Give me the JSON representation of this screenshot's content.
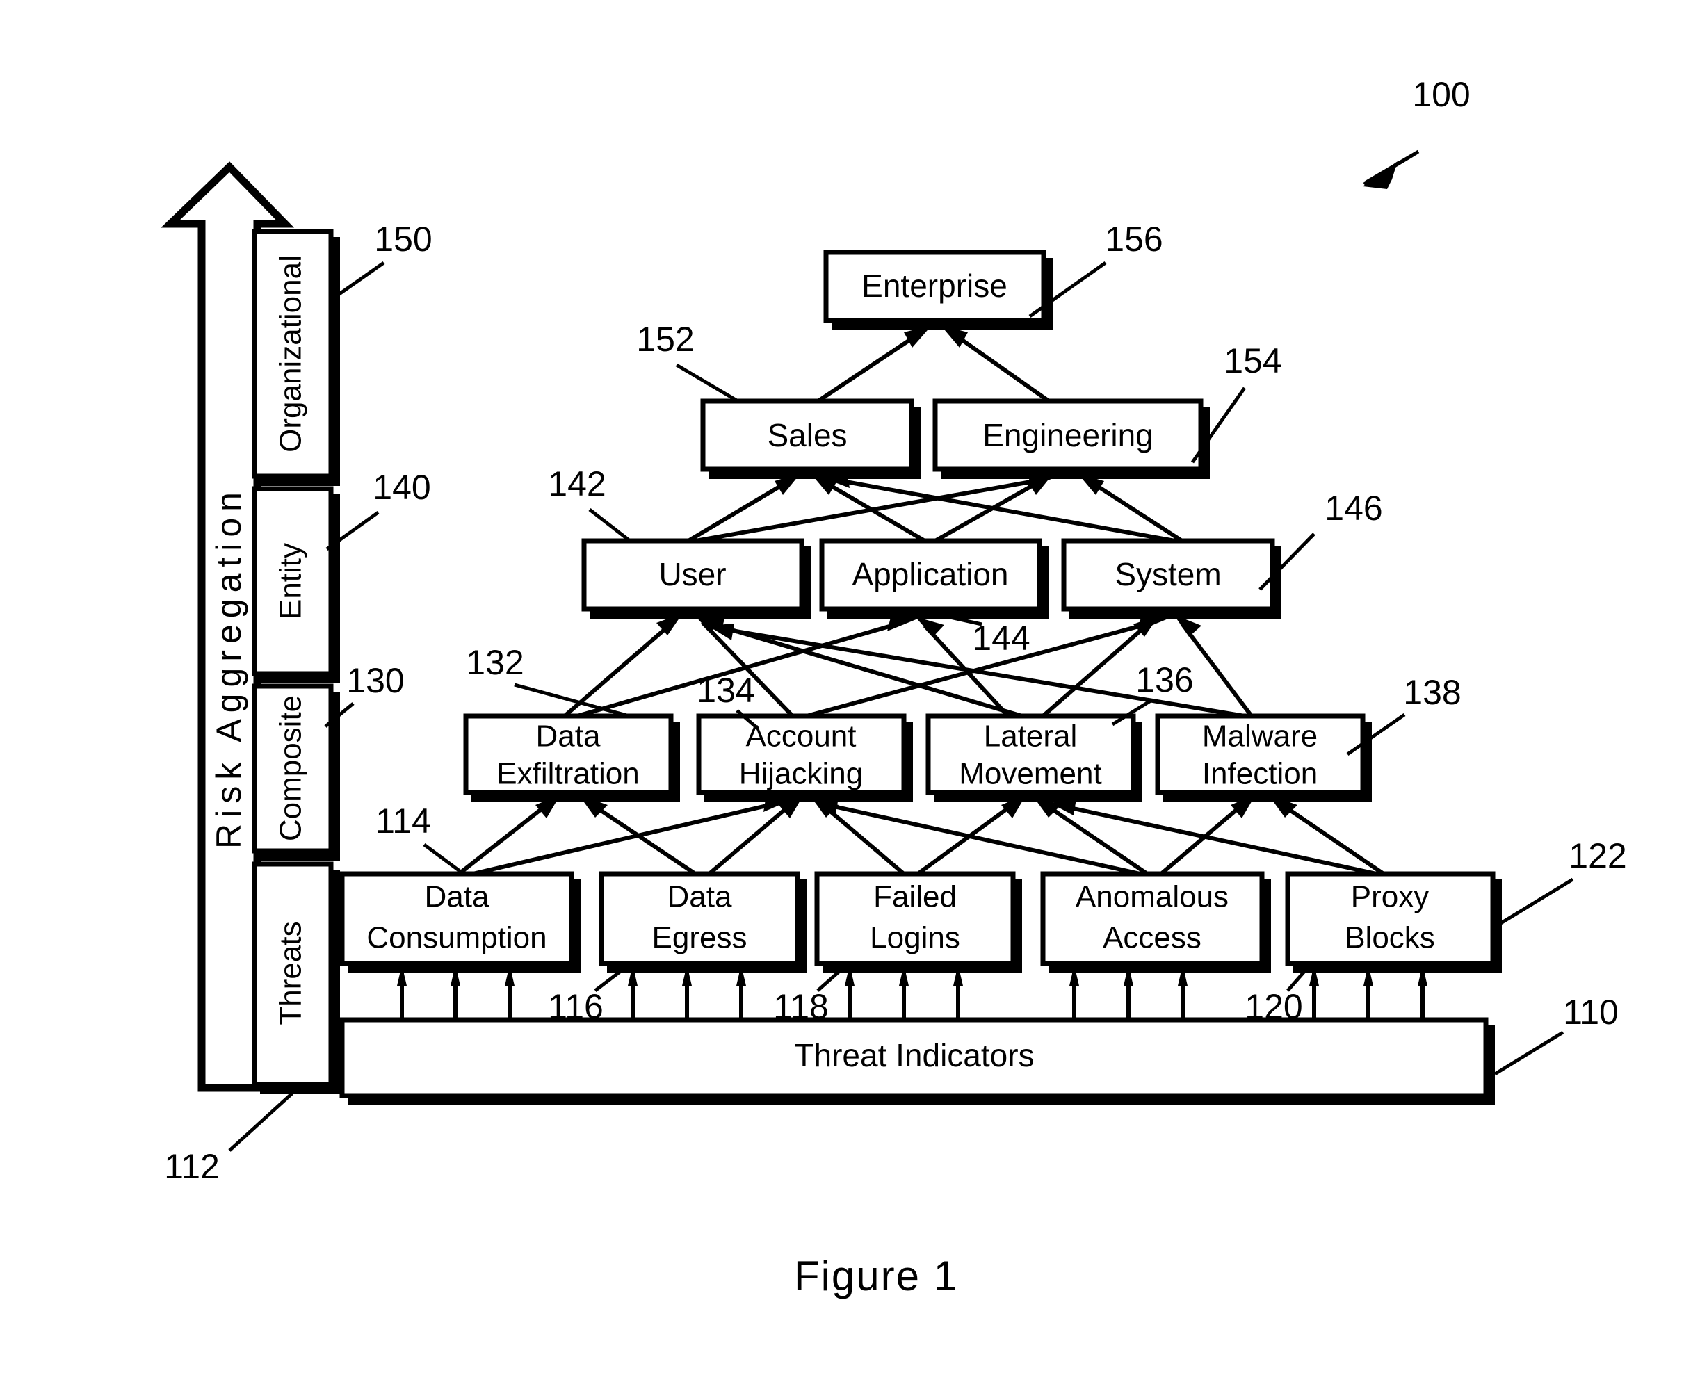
{
  "figure": {
    "caption": "Figure  1",
    "system_ref": "100"
  },
  "axis": {
    "label": "Risk Aggregation",
    "direction": "upward"
  },
  "layers": [
    {
      "label": "Organizational",
      "ref": "150"
    },
    {
      "label": "Entity",
      "ref": "140"
    },
    {
      "label": "Composite",
      "ref": "130"
    },
    {
      "label": "Threats",
      "ref": "112"
    }
  ],
  "organizational": {
    "nodes": [
      {
        "label": "Enterprise",
        "ref": "156"
      },
      {
        "label": "Sales",
        "ref": "152"
      },
      {
        "label": "Engineering",
        "ref": "154"
      }
    ]
  },
  "entity": {
    "nodes": [
      {
        "label": "User",
        "ref": "142"
      },
      {
        "label": "Application",
        "ref": "144"
      },
      {
        "label": "System",
        "ref": "146"
      }
    ]
  },
  "composite": {
    "nodes": [
      {
        "line1": "Data",
        "line2": "Exfiltration",
        "ref": "132"
      },
      {
        "line1": "Account",
        "line2": "Hijacking",
        "ref": "134"
      },
      {
        "line1": "Lateral",
        "line2": "Movement",
        "ref": "136"
      },
      {
        "line1": "Malware",
        "line2": "Infection",
        "ref": "138"
      }
    ]
  },
  "threats": {
    "ref": "114",
    "nodes": [
      {
        "line1": "Data",
        "line2": "Consumption",
        "ref": "114"
      },
      {
        "line1": "Data",
        "line2": "Egress",
        "ref": ""
      },
      {
        "line1": "Failed",
        "line2": "Logins",
        "ref": ""
      },
      {
        "line1": "Anomalous",
        "line2": "Access",
        "ref": ""
      },
      {
        "line1": "Proxy",
        "line2": "Blocks",
        "ref": "122"
      }
    ]
  },
  "indicators": {
    "label": "Threat Indicators",
    "ref": "110",
    "arrow_refs": [
      "116",
      "118",
      "120"
    ]
  },
  "colors": {
    "stroke": "#000000",
    "fill": "#ffffff",
    "background": "#ffffff"
  }
}
